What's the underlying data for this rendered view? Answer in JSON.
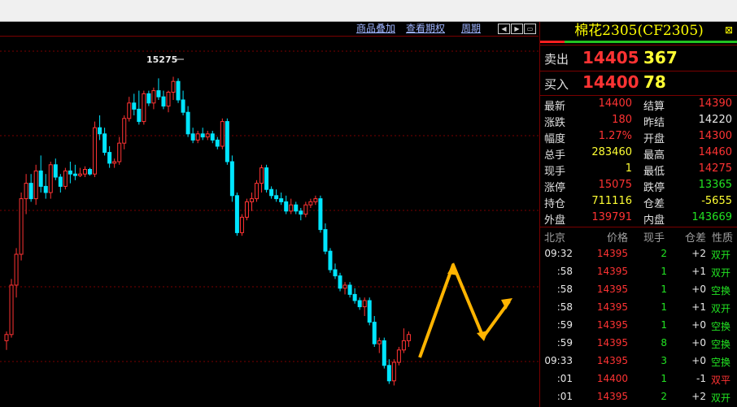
{
  "toolbar": {
    "links": [
      "商品叠加",
      "查看期权",
      "周期"
    ],
    "buttons": [
      "left-arrow",
      "right-arrow",
      "window"
    ]
  },
  "chart_data": {
    "type": "candlestick",
    "annotation_high_label": "15275",
    "ylim": [
      14300,
      15300
    ],
    "colors": {
      "up": "#ff3333",
      "down": "#00e5ff"
    },
    "candles": [
      [
        14420,
        14450,
        14390,
        14440
      ],
      [
        14440,
        14620,
        14430,
        14600
      ],
      [
        14600,
        14720,
        14560,
        14700
      ],
      [
        14700,
        14900,
        14680,
        14880
      ],
      [
        14880,
        14960,
        14830,
        14930
      ],
      [
        14930,
        14960,
        14870,
        14880
      ],
      [
        14880,
        14990,
        14860,
        14970
      ],
      [
        14970,
        15020,
        14900,
        14920
      ],
      [
        14920,
        14960,
        14880,
        14900
      ],
      [
        14900,
        15000,
        14880,
        14990
      ],
      [
        14990,
        15010,
        14940,
        14950
      ],
      [
        14950,
        14960,
        14900,
        14920
      ],
      [
        14920,
        14980,
        14910,
        14970
      ],
      [
        14970,
        15000,
        14930,
        14960
      ],
      [
        14960,
        14990,
        14940,
        14955
      ],
      [
        14955,
        14980,
        14950,
        14960
      ],
      [
        14960,
        14985,
        14950,
        14975
      ],
      [
        14975,
        14980,
        14955,
        14960
      ],
      [
        14960,
        15130,
        14950,
        15110
      ],
      [
        15110,
        15150,
        15070,
        15090
      ],
      [
        15090,
        15110,
        15020,
        15030
      ],
      [
        15030,
        15050,
        14980,
        14995
      ],
      [
        14995,
        15010,
        14980,
        15000
      ],
      [
        15000,
        15080,
        14990,
        15060
      ],
      [
        15060,
        15150,
        15040,
        15140
      ],
      [
        15140,
        15210,
        15130,
        15190
      ],
      [
        15190,
        15220,
        15150,
        15170
      ],
      [
        15170,
        15230,
        15120,
        15130
      ],
      [
        15130,
        15230,
        15120,
        15220
      ],
      [
        15220,
        15230,
        15180,
        15190
      ],
      [
        15190,
        15240,
        15170,
        15230
      ],
      [
        15230,
        15270,
        15200,
        15210
      ],
      [
        15210,
        15230,
        15170,
        15180
      ],
      [
        15180,
        15230,
        15160,
        15225
      ],
      [
        15225,
        15275,
        15200,
        15260
      ],
      [
        15260,
        15270,
        15190,
        15200
      ],
      [
        15200,
        15230,
        15150,
        15160
      ],
      [
        15160,
        15180,
        15080,
        15090
      ],
      [
        15090,
        15110,
        15060,
        15070
      ],
      [
        15070,
        15100,
        15060,
        15090
      ],
      [
        15090,
        15110,
        15070,
        15080
      ],
      [
        15080,
        15100,
        15070,
        15090
      ],
      [
        15090,
        15100,
        15060,
        15070
      ],
      [
        15070,
        15080,
        15040,
        15050
      ],
      [
        15050,
        15140,
        15040,
        15130
      ],
      [
        15130,
        15140,
        14990,
        15000
      ],
      [
        15000,
        15020,
        14870,
        14890
      ],
      [
        14890,
        14900,
        14760,
        14770
      ],
      [
        14770,
        14830,
        14760,
        14820
      ],
      [
        14820,
        14880,
        14810,
        14870
      ],
      [
        14870,
        14900,
        14840,
        14880
      ],
      [
        14880,
        14940,
        14870,
        14930
      ],
      [
        14930,
        14990,
        14900,
        14980
      ],
      [
        14980,
        14990,
        14900,
        14910
      ],
      [
        14910,
        14920,
        14880,
        14890
      ],
      [
        14890,
        14910,
        14870,
        14880
      ],
      [
        14880,
        14900,
        14860,
        14870
      ],
      [
        14870,
        14890,
        14830,
        14840
      ],
      [
        14840,
        14880,
        14830,
        14860
      ],
      [
        14860,
        14870,
        14830,
        14840
      ],
      [
        14840,
        14850,
        14810,
        14830
      ],
      [
        14830,
        14870,
        14820,
        14860
      ],
      [
        14860,
        14880,
        14850,
        14870
      ],
      [
        14870,
        14890,
        14860,
        14880
      ],
      [
        14880,
        14890,
        14770,
        14780
      ],
      [
        14780,
        14800,
        14700,
        14710
      ],
      [
        14710,
        14720,
        14640,
        14650
      ],
      [
        14650,
        14670,
        14620,
        14630
      ],
      [
        14630,
        14640,
        14580,
        14590
      ],
      [
        14590,
        14610,
        14570,
        14600
      ],
      [
        14600,
        14610,
        14560,
        14570
      ],
      [
        14570,
        14590,
        14540,
        14550
      ],
      [
        14550,
        14560,
        14520,
        14530
      ],
      [
        14530,
        14560,
        14500,
        14550
      ],
      [
        14550,
        14560,
        14470,
        14480
      ],
      [
        14480,
        14500,
        14400,
        14410
      ],
      [
        14410,
        14430,
        14380,
        14420
      ],
      [
        14420,
        14430,
        14330,
        14340
      ],
      [
        14340,
        14360,
        14280,
        14290
      ],
      [
        14290,
        14360,
        14275,
        14350
      ],
      [
        14350,
        14400,
        14340,
        14390
      ],
      [
        14390,
        14460,
        14380,
        14420
      ],
      [
        14420,
        14450,
        14400,
        14440
      ]
    ]
  },
  "quote": {
    "title": "棉花2305(CF2305)",
    "sell_label": "卖出",
    "sell_price": "14405",
    "sell_vol": "367",
    "buy_label": "买入",
    "buy_price": "14400",
    "buy_vol": "78",
    "colors": {
      "title": "#ffff00",
      "price": "#ff3333",
      "volume": "#ffff33"
    }
  },
  "stats": [
    {
      "l1": "最新",
      "v1": "14400",
      "c1": "red",
      "l2": "结算",
      "v2": "14390",
      "c2": "red"
    },
    {
      "l1": "涨跌",
      "v1": "180",
      "c1": "red",
      "l2": "昨结",
      "v2": "14220",
      "c2": "white"
    },
    {
      "l1": "幅度",
      "v1": "1.27%",
      "c1": "red",
      "l2": "开盘",
      "v2": "14300",
      "c2": "red"
    },
    {
      "l1": "总手",
      "v1": "283460",
      "c1": "yellow",
      "l2": "最高",
      "v2": "14460",
      "c2": "red"
    },
    {
      "l1": "现手",
      "v1": "1",
      "c1": "yellow",
      "l2": "最低",
      "v2": "14275",
      "c2": "red"
    },
    {
      "l1": "涨停",
      "v1": "15075",
      "c1": "red",
      "l2": "跌停",
      "v2": "13365",
      "c2": "green"
    },
    {
      "l1": "持仓",
      "v1": "711116",
      "c1": "yellow",
      "l2": "仓差",
      "v2": "-5655",
      "c2": "yellow"
    },
    {
      "l1": "外盘",
      "v1": "139791",
      "c1": "red",
      "l2": "内盘",
      "v2": "143669",
      "c2": "green"
    }
  ],
  "trades_header": [
    "北京",
    "价格",
    "现手",
    "仓差",
    "性质"
  ],
  "trades": [
    {
      "time": "09:32",
      "price": "14395",
      "vol": "2",
      "diff": "+2",
      "nature": "双开",
      "nc": "green"
    },
    {
      "time": ":58",
      "price": "14395",
      "vol": "1",
      "diff": "+1",
      "nature": "双开",
      "nc": "green"
    },
    {
      "time": ":58",
      "price": "14395",
      "vol": "1",
      "diff": "+0",
      "nature": "空换",
      "nc": "green"
    },
    {
      "time": ":58",
      "price": "14395",
      "vol": "1",
      "diff": "+1",
      "nature": "双开",
      "nc": "green"
    },
    {
      "time": ":59",
      "price": "14395",
      "vol": "1",
      "diff": "+0",
      "nature": "空换",
      "nc": "green"
    },
    {
      "time": ":59",
      "price": "14395",
      "vol": "8",
      "diff": "+0",
      "nature": "空换",
      "nc": "green"
    },
    {
      "time": "09:33",
      "price": "14395",
      "vol": "3",
      "diff": "+0",
      "nature": "空换",
      "nc": "green"
    },
    {
      "time": ":01",
      "price": "14400",
      "vol": "1",
      "diff": "-1",
      "nature": "双平",
      "nc": "red"
    },
    {
      "time": ":01",
      "price": "14395",
      "vol": "2",
      "diff": "+2",
      "nature": "双开",
      "nc": "green"
    }
  ]
}
